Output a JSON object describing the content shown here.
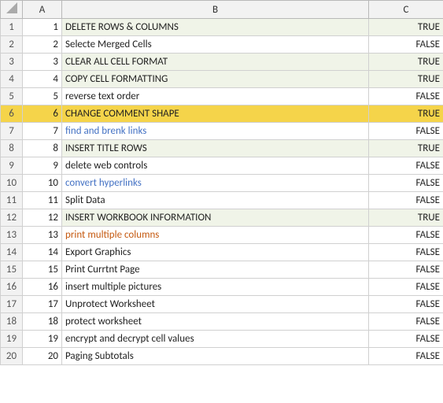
{
  "columns": {
    "row_header": "",
    "a_header": "A",
    "b_header": "B",
    "c_header": "C"
  },
  "rows": [
    {
      "row": 1,
      "num": 1,
      "text": "DELETE ROWS & COLUMNS",
      "bool": "TRUE",
      "true_row": true,
      "highlight": false,
      "text_class": "text-default"
    },
    {
      "row": 2,
      "num": 2,
      "text": "Selecte Merged Cells",
      "bool": "FALSE",
      "true_row": false,
      "highlight": false,
      "text_class": "text-default"
    },
    {
      "row": 3,
      "num": 3,
      "text": "CLEAR ALL CELL FORMAT",
      "bool": "TRUE",
      "true_row": true,
      "highlight": false,
      "text_class": "text-default"
    },
    {
      "row": 4,
      "num": 4,
      "text": "COPY CELL FORMATTING",
      "bool": "TRUE",
      "true_row": true,
      "highlight": false,
      "text_class": "text-default"
    },
    {
      "row": 5,
      "num": 5,
      "text": "reverse text order",
      "bool": "FALSE",
      "true_row": false,
      "highlight": false,
      "text_class": "text-default"
    },
    {
      "row": 6,
      "num": 6,
      "text": "CHANGE COMMENT SHAPE",
      "bool": "TRUE",
      "true_row": false,
      "highlight": true,
      "text_class": "text-default"
    },
    {
      "row": 7,
      "num": 7,
      "text": "find and brenk links",
      "bool": "FALSE",
      "true_row": false,
      "highlight": false,
      "text_class": "text-blue"
    },
    {
      "row": 8,
      "num": 8,
      "text": "INSERT TITLE ROWS",
      "bool": "TRUE",
      "true_row": true,
      "highlight": false,
      "text_class": "text-default"
    },
    {
      "row": 9,
      "num": 9,
      "text": "delete web controls",
      "bool": "FALSE",
      "true_row": false,
      "highlight": false,
      "text_class": "text-default"
    },
    {
      "row": 10,
      "num": 10,
      "text": "convert hyperlinks",
      "bool": "FALSE",
      "true_row": false,
      "highlight": false,
      "text_class": "text-blue"
    },
    {
      "row": 11,
      "num": 11,
      "text": "Split Data",
      "bool": "FALSE",
      "true_row": false,
      "highlight": false,
      "text_class": "text-default"
    },
    {
      "row": 12,
      "num": 12,
      "text": "INSERT WORKBOOK INFORMATION",
      "bool": "TRUE",
      "true_row": true,
      "highlight": false,
      "text_class": "text-default"
    },
    {
      "row": 13,
      "num": 13,
      "text": "print multiple columns",
      "bool": "FALSE",
      "true_row": false,
      "highlight": false,
      "text_class": "text-orange"
    },
    {
      "row": 14,
      "num": 14,
      "text": "Export Graphics",
      "bool": "FALSE",
      "true_row": false,
      "highlight": false,
      "text_class": "text-default"
    },
    {
      "row": 15,
      "num": 15,
      "text": "Print Currtnt Page",
      "bool": "FALSE",
      "true_row": false,
      "highlight": false,
      "text_class": "text-default"
    },
    {
      "row": 16,
      "num": 16,
      "text": "insert multiple pictures",
      "bool": "FALSE",
      "true_row": false,
      "highlight": false,
      "text_class": "text-default"
    },
    {
      "row": 17,
      "num": 17,
      "text": "Unprotect Worksheet",
      "bool": "FALSE",
      "true_row": false,
      "highlight": false,
      "text_class": "text-default"
    },
    {
      "row": 18,
      "num": 18,
      "text": "protect worksheet",
      "bool": "FALSE",
      "true_row": false,
      "highlight": false,
      "text_class": "text-default"
    },
    {
      "row": 19,
      "num": 19,
      "text": "encrypt and decrypt cell values",
      "bool": "FALSE",
      "true_row": false,
      "highlight": false,
      "text_class": "text-default"
    },
    {
      "row": 20,
      "num": 20,
      "text": "Paging Subtotals",
      "bool": "FALSE",
      "true_row": false,
      "highlight": false,
      "text_class": "text-default"
    }
  ]
}
